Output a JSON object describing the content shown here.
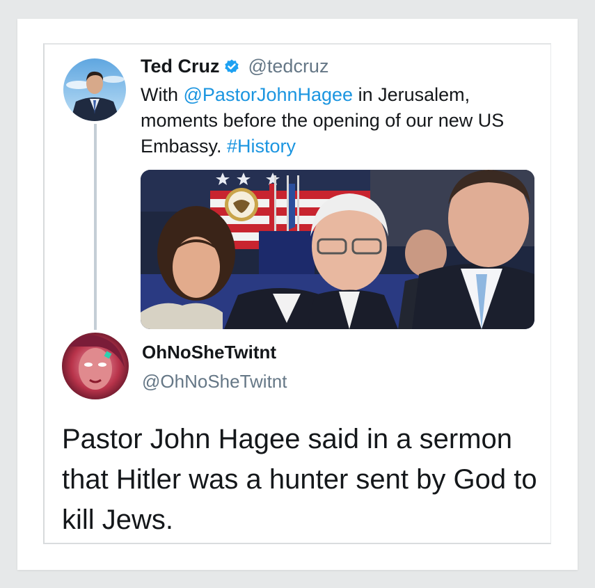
{
  "tweet1": {
    "name": "Ted Cruz",
    "handle": "@tedcruz",
    "text_before": "With ",
    "mention": "@PastorJohnHagee",
    "text_middle": " in Jerusalem, moments before the opening of our new US Embassy. ",
    "hashtag": "#History",
    "verified_icon": "verified-badge-icon",
    "image": "photo-of-four-people-at-embassy-ceremony"
  },
  "tweet2": {
    "name": "OhNoSheTwitnt",
    "handle": "@OhNoSheTwitnt",
    "text": "Pastor John Hagee said in a sermon that Hitler was a hunter sent by God to kill Jews."
  },
  "colors": {
    "page_background": "#e6e8e9",
    "link": "#1b95e0",
    "text": "#14171a",
    "secondary_text": "#657786",
    "verified_badge": "#1da1f2",
    "thread_line": "#c4ced6"
  }
}
